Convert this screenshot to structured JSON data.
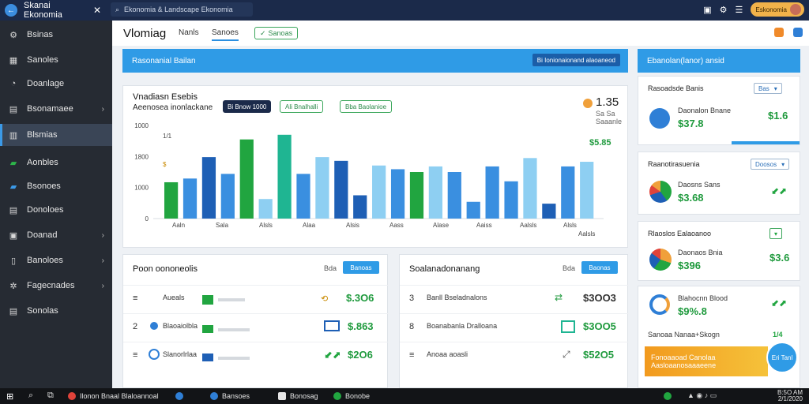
{
  "titlebar": {
    "app_name": "Skanai Ekonomia",
    "close_glyph": "✕",
    "search_text": "Ekonomia & Landscape Ekonomia",
    "user_label": "Eskonomia"
  },
  "sidebar": {
    "items": [
      {
        "label": "Bsinas",
        "icon": "gear-icon"
      },
      {
        "label": "Sanoles",
        "icon": "grid-icon"
      },
      {
        "label": "Doanlage",
        "icon": "gauge-icon"
      },
      {
        "label": "Bsonamaee",
        "icon": "building-icon",
        "chevron": true
      },
      {
        "label": "Blsmias",
        "icon": "chart-icon",
        "active": true
      },
      {
        "label": "Aonbles",
        "icon": "folder-icon"
      },
      {
        "label": "Bsonoes",
        "icon": "book-icon"
      },
      {
        "label": "Donoloes",
        "icon": "list-icon"
      },
      {
        "label": "Doanad",
        "icon": "briefcase-icon",
        "chevron": true
      },
      {
        "label": "Banoloes",
        "icon": "doc-icon",
        "chevron": true
      },
      {
        "label": "Fagecnades",
        "icon": "settings-icon",
        "chevron": true
      },
      {
        "label": "Sonolas",
        "icon": "table-icon"
      }
    ]
  },
  "header": {
    "title": "Vlomiag",
    "tabs": [
      "Nanls",
      "Sanoes"
    ],
    "active_tab": "Sanoes",
    "pill_label": "Sanoas"
  },
  "banner": {
    "left_title": "Rasonanial Bailan",
    "left_button": "Bi Ionionaionand alaoaneod",
    "right_title": "Ebanolan(lanor) ansid"
  },
  "chart_card": {
    "title": "Vnadiasn Esebis",
    "subtitle": "Aeenosea inonlackane",
    "filters": [
      "Bi Bnow 1000",
      "Ali Bnalhalli",
      "Bba Baolanioe"
    ],
    "big_value": "1.35",
    "sub_value": "Sa Sa Saaanle",
    "green_value": "$5.85"
  },
  "chart_data": {
    "type": "bar",
    "y_ticks": [
      "1000",
      "1800",
      "1000",
      "0"
    ],
    "annotations": [
      "1/1",
      "$"
    ],
    "categories": [
      "Aaln",
      "Sala",
      "Alsls",
      "Alaa",
      "Alsis",
      "Aass",
      "Alase",
      "Aaiss",
      "Aalsls",
      "Alsls"
    ],
    "values": [
      39,
      43,
      66,
      48,
      85,
      21,
      90,
      48,
      66,
      62,
      25,
      57,
      53,
      50,
      56,
      50,
      18,
      56,
      40,
      65,
      16,
      56,
      61
    ],
    "colors": [
      "#21a540",
      "#3a8fe0",
      "#1e5fb5",
      "#3a8fe0",
      "#21a540",
      "#8ecff2",
      "#1fb592",
      "#3a8fe0",
      "#8ecff2",
      "#1e5fb5",
      "#1e5fb5",
      "#8ecff2",
      "#3a8fe0",
      "#21a540",
      "#8ecff2",
      "#3a8fe0",
      "#3a8fe0",
      "#3a8fe0",
      "#3a8fe0",
      "#8ecff2",
      "#1e5fb5",
      "#3a8fe0",
      "#8ecff2"
    ],
    "extra_label": "Aalsls"
  },
  "list_left": {
    "title": "Poon oononeolis",
    "right_text": "Bda",
    "button": "Banoas",
    "rows": [
      {
        "idx": "≡",
        "label": "Aueals",
        "amount": "$.3O6"
      },
      {
        "idx": "2",
        "label": "Blaoaiolbla",
        "amount": "$.863"
      },
      {
        "idx": "≡",
        "label": "Slanorlrlaa",
        "amount": "$2O6"
      }
    ]
  },
  "list_right": {
    "title": "Soalanadonanang",
    "right_text": "Bda",
    "button": "Baonas",
    "rows": [
      {
        "idx": "3",
        "label": "Banll Bseladnalons",
        "amount": "$3OO3"
      },
      {
        "idx": "8",
        "label": "Boanabanla Dralloana",
        "amount": "$3OO5"
      },
      {
        "idx": "≡",
        "label": "Anoaa aoasli",
        "amount": "$52O5"
      }
    ]
  },
  "right_cards": {
    "c1_title": "Rasoadsde Banis",
    "c1_select": "Bas",
    "c1_label": "Daonalon Bnane",
    "c1_val_left": "$37.8",
    "c1_val_right": "$1.6",
    "c2_title": "Raanotirasuenia",
    "c2_select": "Doosos",
    "c2_label": "Daosns Sans",
    "c2_val": "$3.68",
    "c3_title": "Rlaoslos Ealaoanoo",
    "c3_label": "Daonaos Bnia",
    "c3_val_left": "$396",
    "c3_val_right": "$3.6",
    "c4_label": "Blahocnn Blood",
    "c4_val": "$9%.8",
    "c5_label": "Sanoaa Nanaa+Skogn",
    "c5_right": "1/4",
    "banner_text": "Fonoaaoad Canolaa Aasloaanosaaaeene",
    "fab_label": "Eri Tanl"
  },
  "taskbar": {
    "items": [
      "Ilonon Bnaal Blaloannoal",
      "Bansoes",
      "Bonosag",
      "Bonobe"
    ],
    "clock_time": "B:5O AM",
    "clock_date": "2/1/2020"
  }
}
